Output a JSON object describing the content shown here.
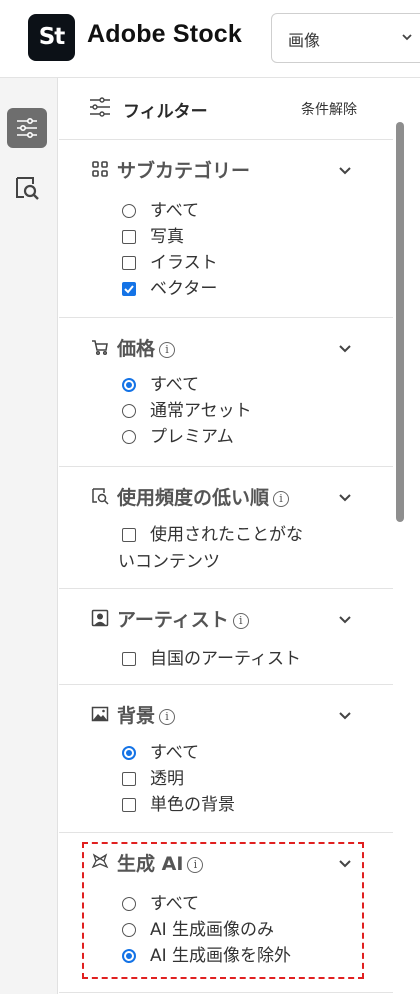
{
  "header": {
    "logo_text": "St",
    "brand": "Adobe Stock",
    "type_select": {
      "value": "画像"
    }
  },
  "rail": {
    "items": [
      {
        "icon": "sliders-icon",
        "active": true
      },
      {
        "icon": "search-preview-icon",
        "active": false
      }
    ]
  },
  "filter": {
    "title": "フィルター",
    "clear_label": "条件解除",
    "sections": [
      {
        "title": "サブカテゴリー",
        "icon": "grid-icon",
        "info": false,
        "options": [
          {
            "label": "すべて",
            "type": "radio",
            "checked": false
          },
          {
            "label": "写真",
            "type": "checkbox",
            "checked": false
          },
          {
            "label": "イラスト",
            "type": "checkbox",
            "checked": false
          },
          {
            "label": "ベクター",
            "type": "checkbox",
            "checked": true
          }
        ]
      },
      {
        "title": "価格",
        "icon": "cart-icon",
        "info": true,
        "options": [
          {
            "label": "すべて",
            "type": "radio",
            "checked": true
          },
          {
            "label": "通常アセット",
            "type": "radio",
            "checked": false
          },
          {
            "label": "プレミアム",
            "type": "radio",
            "checked": false
          }
        ]
      },
      {
        "title": "使用頻度の低い順",
        "icon": "search-preview-icon",
        "info": true,
        "options": [
          {
            "label": "使用されたことがな",
            "label2": "いコンテンツ",
            "type": "checkbox",
            "checked": false
          }
        ]
      },
      {
        "title": "アーティスト",
        "icon": "person-icon",
        "info": true,
        "options": [
          {
            "label": "自国のアーティスト",
            "type": "checkbox",
            "checked": false
          }
        ]
      },
      {
        "title": "背景",
        "icon": "image-icon",
        "info": true,
        "options": [
          {
            "label": "すべて",
            "type": "radio",
            "checked": true
          },
          {
            "label": "透明",
            "type": "checkbox",
            "checked": false
          },
          {
            "label": "単色の背景",
            "type": "checkbox",
            "checked": false
          }
        ]
      },
      {
        "title": "生成 AI",
        "icon": "ai-icon",
        "info": true,
        "options": [
          {
            "label": "すべて",
            "type": "radio",
            "checked": false
          },
          {
            "label": "AI 生成画像のみ",
            "type": "radio",
            "checked": false
          },
          {
            "label": "AI 生成画像を除外",
            "type": "radio",
            "checked": true
          }
        ]
      }
    ]
  },
  "colors": {
    "accent": "#1473e6",
    "highlight_dash": "#e02020",
    "logo_bg": "#0c1117"
  }
}
